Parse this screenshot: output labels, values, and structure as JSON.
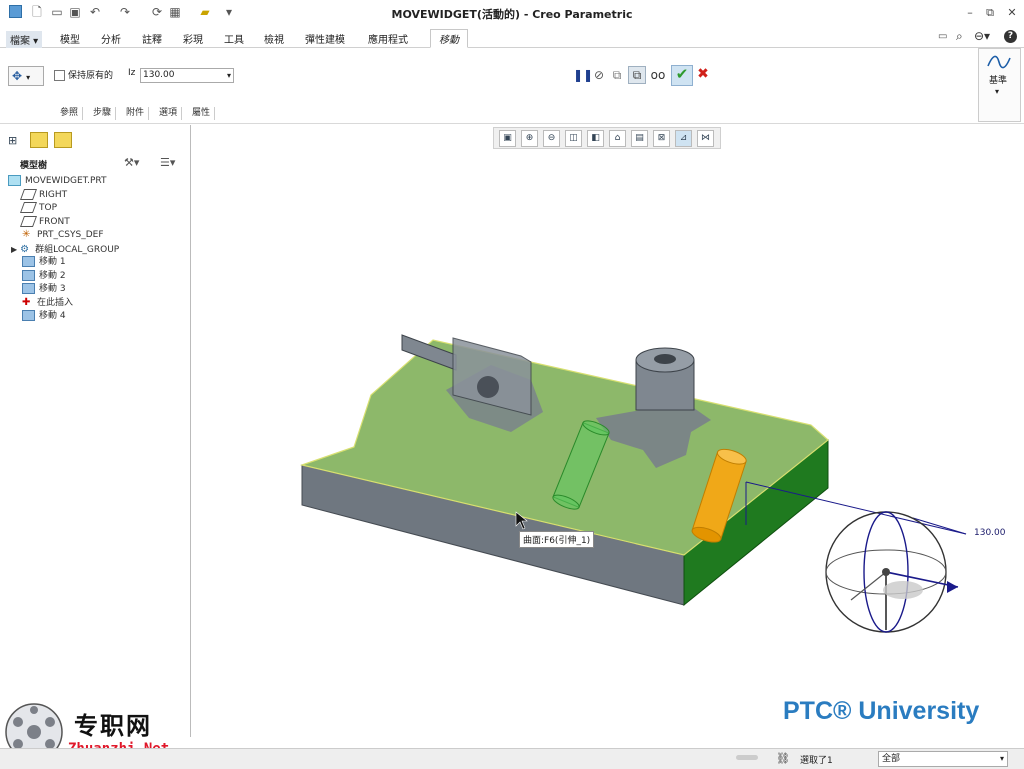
{
  "window": {
    "title": "MOVEWIDGET(活動的) - Creo Parametric",
    "controls": [
      "–",
      "⧉",
      "✕"
    ]
  },
  "menubar": {
    "items": [
      "檔案",
      "模型",
      "分析",
      "註釋",
      "彩現",
      "工具",
      "檢視",
      "彈性建模",
      "應用程式",
      "移動"
    ],
    "active": "移動"
  },
  "ribbon": {
    "keep_original_label": "保持原有的",
    "value_prefix": "Iz",
    "value": "130.00",
    "subtabs": [
      "參照",
      "步驟",
      "附件",
      "選項",
      "屬性"
    ],
    "datum_label": "基準"
  },
  "tree": {
    "title": "模型樹",
    "items": [
      "MOVEWIDGET.PRT",
      "RIGHT",
      "TOP",
      "FRONT",
      "PRT_CSYS_DEF",
      "群組LOCAL_GROUP",
      "移動 1",
      "移動 2",
      "移動 3",
      "在此插入",
      "移動 4"
    ]
  },
  "viewport": {
    "tooltip": "曲面:F6(引伸_1)",
    "dimension": "130.00",
    "brand": "PTC® University"
  },
  "watermark": {
    "cn": "专职网",
    "url": "Zhuanzhi.Net"
  },
  "status": {
    "selected": "選取了1",
    "filter": "全部"
  },
  "colors": {
    "accept": "#2e9a2e",
    "cancel": "#d0201a",
    "part_gray": "#8a929c",
    "highlight_green": "#7fb05a",
    "orange": "#f0a818",
    "brand_blue": "#2a7cc0"
  }
}
